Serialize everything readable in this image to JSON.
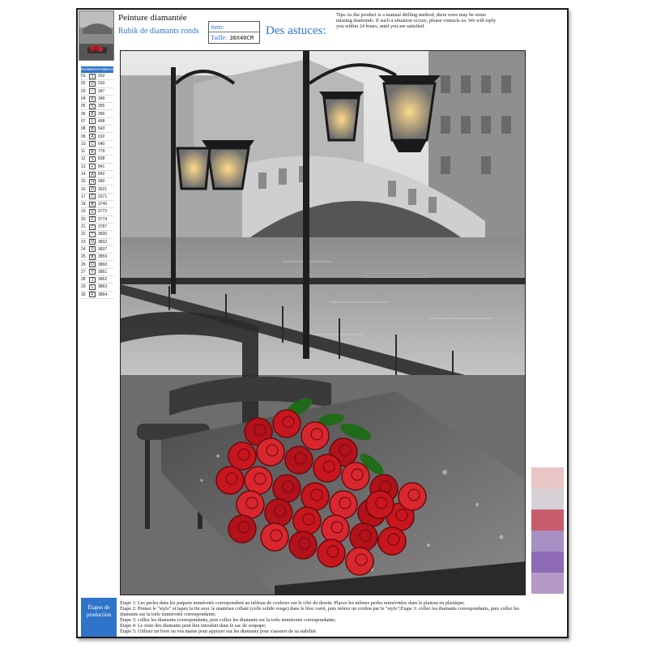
{
  "header": {
    "title": "Peinture diamantée",
    "subtitle": "Rubik de diamants ronds",
    "item_label": "item:",
    "size_label": "Taille:",
    "size_value": "30X40CM",
    "astuces": "Des astuces:",
    "tips": "Tips:As the product is a manual drilling method, there were may be some missing diamonds. If such a situation occurs, please contacts us. We will reply you within 24 hours, until you are satisfied."
  },
  "legend": {
    "headers": [
      "NUMBER",
      "SYMBOL",
      "DMC"
    ],
    "rows": [
      {
        "n": "01",
        "s": "1",
        "c": "152"
      },
      {
        "n": "02",
        "s": "O",
        "c": "310"
      },
      {
        "n": "03",
        "s": "□",
        "c": "347"
      },
      {
        "n": "04",
        "s": "K",
        "c": "349"
      },
      {
        "n": "05",
        "s": "S",
        "c": "355"
      },
      {
        "n": "06",
        "s": "B",
        "c": "356"
      },
      {
        "n": "07",
        "s": "L",
        "c": "498"
      },
      {
        "n": "08",
        "s": "B",
        "c": "543"
      },
      {
        "n": "09",
        "s": "A",
        "c": "632"
      },
      {
        "n": "10",
        "s": "C",
        "c": "640"
      },
      {
        "n": "11",
        "s": "B",
        "c": "779"
      },
      {
        "n": "12",
        "s": "S",
        "c": "838"
      },
      {
        "n": "13",
        "s": "≡",
        "c": "841"
      },
      {
        "n": "14",
        "s": "A",
        "c": "842"
      },
      {
        "n": "15",
        "s": "H",
        "c": "950"
      },
      {
        "n": "16",
        "s": "D",
        "c": "3021"
      },
      {
        "n": "17",
        "s": "C",
        "c": "3371"
      },
      {
        "n": "18",
        "s": "B",
        "c": "3740"
      },
      {
        "n": "19",
        "s": "X",
        "c": "3772"
      },
      {
        "n": "20",
        "s": "F",
        "c": "3774"
      },
      {
        "n": "21",
        "s": "C",
        "c": "3787"
      },
      {
        "n": "22",
        "s": "T",
        "c": "3830"
      },
      {
        "n": "23",
        "s": "N",
        "c": "3832"
      },
      {
        "n": "24",
        "s": "S",
        "c": "3837"
      },
      {
        "n": "25",
        "s": "B",
        "c": "3859"
      },
      {
        "n": "26",
        "s": "O",
        "c": "3860"
      },
      {
        "n": "27",
        "s": "Y",
        "c": "3861"
      },
      {
        "n": "28",
        "s": "J",
        "c": "3862"
      },
      {
        "n": "29",
        "s": "L",
        "c": "3863"
      },
      {
        "n": "30",
        "s": "K",
        "c": "3864"
      }
    ]
  },
  "steps_button": [
    "Étapes de",
    "production"
  ],
  "steps": [
    "Étape 1: Les perles dans les paquets numérotés correspondent au tableau de couleurs sur le côté du dessin. Placez les mêmes perles numérotées dans le plateau en plastique;",
    "Étape 2: Prenez le \"stylo\" et tapez la fin avec le matériau collant (colle solide rouge) dans le bloc carré, puis retirez un cordon par le \"stylo\";Étape 3: collez les diamants correspondants, puis collez les diamants sur la toile numérotée correspondante;",
    "Étape 3: collez les diamants correspondants, puis collez les diamants sur la toile numérotée correspondante;",
    "Étape 4: Le reste des diamants peut être introduit dans le sac de soupape;",
    "Étape 5: Utiliser un livre ou vos mains pour appuyer sur les diamants pour s'assurer de sa stabilité."
  ],
  "colors": {
    "accent": "#2e74c9",
    "rose": "#c8161e",
    "leaf": "#1f6b1a"
  }
}
